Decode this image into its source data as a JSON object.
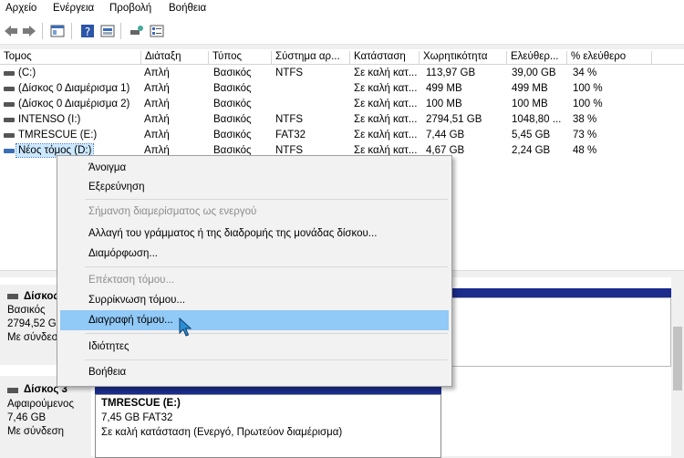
{
  "menu": [
    "Αρχείο",
    "Ενέργεια",
    "Προβολή",
    "Βοήθεια"
  ],
  "toolbar": [
    "back-icon",
    "forward-icon",
    "properties-icon",
    "help-icon",
    "disk-view-icon",
    "rescan-icon",
    "volume-list-icon"
  ],
  "columns": [
    "Τομος",
    "Διάταξη",
    "Τύπος",
    "Σύστημα αρ...",
    "Κατάσταση",
    "Χωρητικότητα",
    "Ελεύθερ...",
    "% ελεύθερο"
  ],
  "volumes": [
    [
      "(C:)",
      "Απλή",
      "Βασικός",
      "NTFS",
      "Σε καλή κατ...",
      "113,97 GB",
      "39,00 GB",
      "34 %"
    ],
    [
      "(Δίσκος 0 Διαμέρισμα 1)",
      "Απλή",
      "Βασικός",
      "",
      "Σε καλή κατ...",
      "499 MB",
      "499 MB",
      "100 %"
    ],
    [
      "(Δίσκος 0 Διαμέρισμα 2)",
      "Απλή",
      "Βασικός",
      "",
      "Σε καλή κατ...",
      "100 MB",
      "100 MB",
      "100 %"
    ],
    [
      "INTENSO (I:)",
      "Απλή",
      "Βασικός",
      "NTFS",
      "Σε καλή κατ...",
      "2794,51 GB",
      "1048,80 ...",
      "38 %"
    ],
    [
      "TMRESCUE (E:)",
      "Απλή",
      "Βασικός",
      "FAT32",
      "Σε καλή κατ...",
      "7,44 GB",
      "5,45 GB",
      "73 %"
    ],
    [
      "Νέος τόμος (D:)",
      "Απλή",
      "Βασικός",
      "NTFS",
      "Σε καλή κατ...",
      "4,67 GB",
      "2,24 GB",
      "48 %"
    ]
  ],
  "disks": [
    {
      "name": "Δίσκος",
      "type": "Βασικός",
      "size": "2794,52 GB",
      "status": "Με σύνδεσ"
    },
    {
      "name": "Δίσκος 3",
      "type": "Αφαιρούμενος",
      "size": "7,46 GB",
      "status": "Με σύνδεση"
    }
  ],
  "partition": {
    "name": "TMRESCUE  (E:)",
    "size": "7,45 GB FAT32",
    "status": "Σε καλή κατάσταση (Ενεργό, Πρωτεύον διαμέρισμα)"
  },
  "context_menu": {
    "open": "Άνοιγμα",
    "explore": "Εξερεύνηση",
    "mark_active": "Σήμανση διαμερίσματος ως ενεργού",
    "change_letter": "Αλλαγή του γράμματος ή της διαδρομής της μονάδας δίσκου...",
    "format": "Διαμόρφωση...",
    "extend": "Επέκταση τόμου...",
    "shrink": "Συρρίκνωση τόμου...",
    "delete": "Διαγραφή τόμου...",
    "properties": "Ιδιότητες",
    "help": "Βοήθεια"
  },
  "colors": {
    "selection": "#cce8ff",
    "menu_highlight": "#91c9f7",
    "primary_partition": "#1b2c8c"
  }
}
